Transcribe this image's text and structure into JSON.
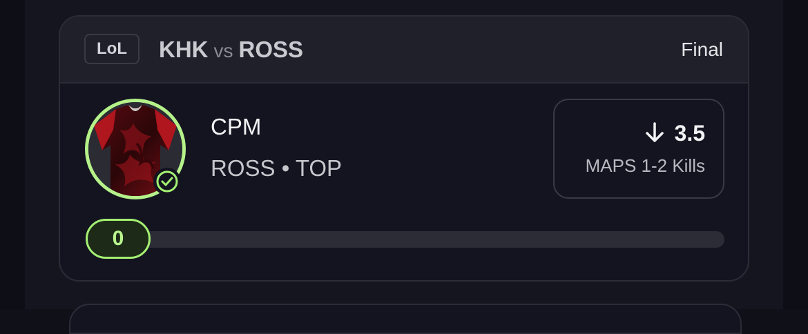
{
  "header": {
    "game_tag": "LoL",
    "team_home": "KHK",
    "vs_label": "vs",
    "team_away": "ROSS",
    "status": "Final"
  },
  "player": {
    "name": "CPM",
    "team_position": "ROSS • TOP",
    "avatar_icon": "jersey-avatar",
    "status_icon": "check-circle-icon"
  },
  "projection": {
    "direction_icon": "arrow-down-icon",
    "line": "3.5",
    "stat_label": "MAPS 1-2 Kills"
  },
  "progress": {
    "value": "0",
    "fraction": 0
  },
  "colors": {
    "accent_green": "#a4f072",
    "card_bg": "#141420",
    "header_bg": "#20202b"
  }
}
